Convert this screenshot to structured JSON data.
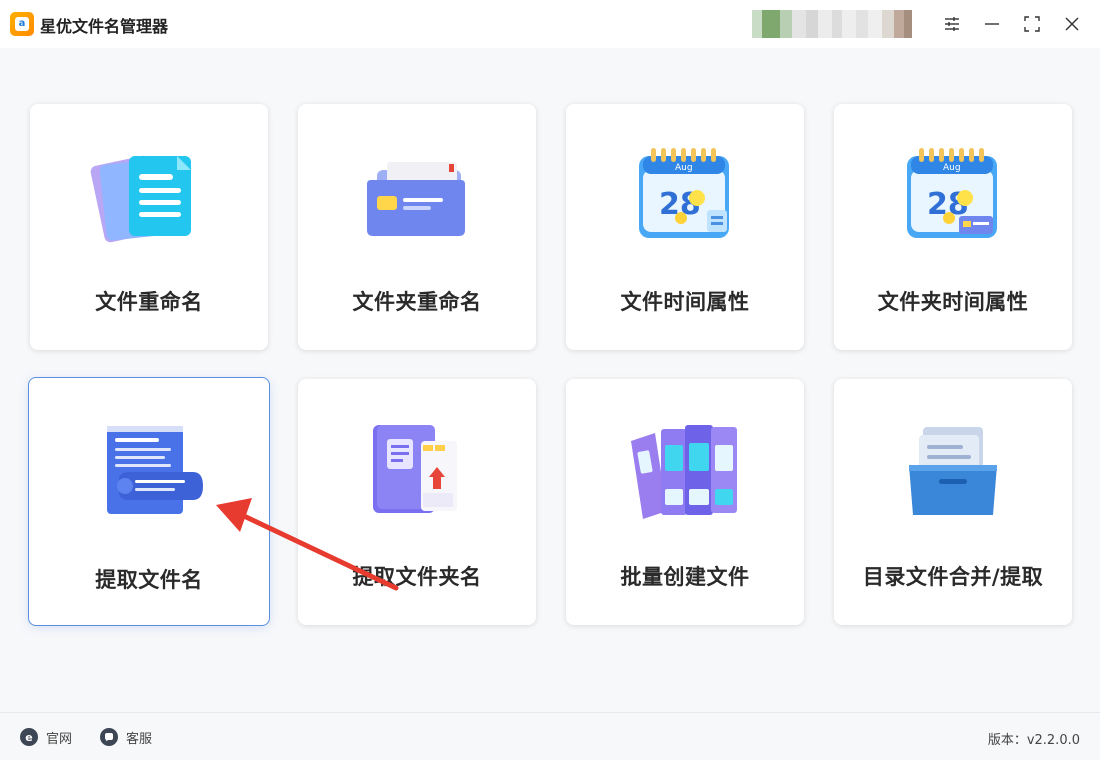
{
  "app": {
    "title": "星优文件名管理器",
    "logo_letter": "a"
  },
  "window_controls": {
    "settings": "settings-icon",
    "minimize": "minimize-icon",
    "maximize": "maximize-icon",
    "close": "close-icon"
  },
  "cards": [
    {
      "label": "文件重命名",
      "icon": "documents-icon"
    },
    {
      "label": "文件夹重命名",
      "icon": "folder-icon"
    },
    {
      "label": "文件时间属性",
      "icon": "calendar-icon",
      "calendar_month": "Aug",
      "calendar_day": "28"
    },
    {
      "label": "文件夹时间属性",
      "icon": "calendar-folder-icon",
      "calendar_month": "Aug",
      "calendar_day": "28"
    },
    {
      "label": "提取文件名",
      "icon": "scroll-list-icon",
      "selected": true
    },
    {
      "label": "提取文件夹名",
      "icon": "book-folder-icon"
    },
    {
      "label": "批量创建文件",
      "icon": "binders-icon"
    },
    {
      "label": "目录文件合并/提取",
      "icon": "file-drawer-icon"
    }
  ],
  "footer": {
    "website": "官网",
    "support": "客服",
    "version": "版本：v2.2.0.0"
  },
  "colors": {
    "accent": "#5b8fe0",
    "annotation_arrow": "#e83b30",
    "logo": "#ff9a00"
  }
}
